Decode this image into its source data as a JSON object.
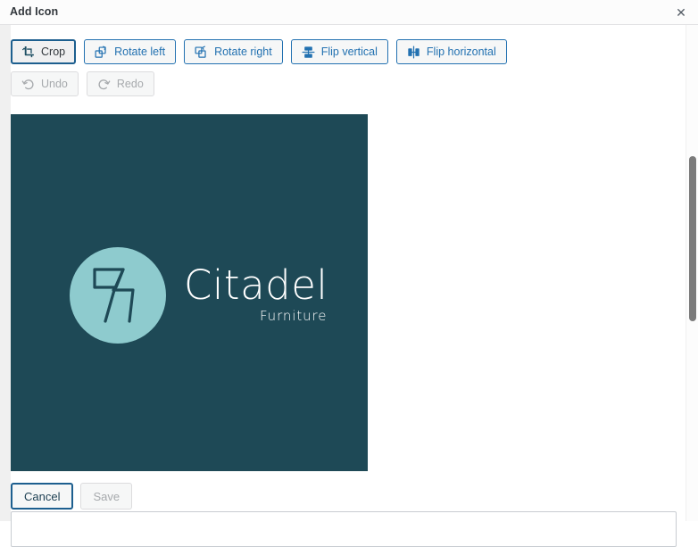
{
  "header": {
    "title": "Add Icon",
    "close_label": "✕"
  },
  "toolbar": {
    "transform": [
      {
        "label": "Crop",
        "icon": "crop-icon",
        "state": "active"
      },
      {
        "label": "Rotate left",
        "icon": "rotate-left-icon",
        "state": "enabled"
      },
      {
        "label": "Rotate right",
        "icon": "rotate-right-icon",
        "state": "enabled"
      },
      {
        "label": "Flip vertical",
        "icon": "flip-vertical-icon",
        "state": "enabled"
      },
      {
        "label": "Flip horizontal",
        "icon": "flip-horizontal-icon",
        "state": "enabled"
      }
    ],
    "history": [
      {
        "label": "Undo",
        "icon": "undo-icon",
        "state": "disabled"
      },
      {
        "label": "Redo",
        "icon": "redo-icon",
        "state": "disabled"
      }
    ]
  },
  "image": {
    "background_color": "#1e4956",
    "logo_circle_color": "#8ecbce",
    "logo_mark_color": "#1e4956",
    "brand_name": "Citadel",
    "brand_subtitle": "Furniture"
  },
  "footer": {
    "cancel_label": "Cancel",
    "save_label": "Save",
    "save_state": "disabled"
  },
  "colors": {
    "accent": "#2271b1",
    "accent_dark": "#1d5f8f",
    "disabled_text": "#a7aaad"
  }
}
